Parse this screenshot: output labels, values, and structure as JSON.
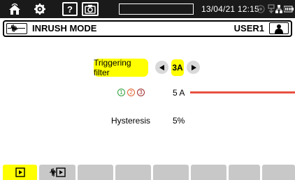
{
  "statusbar": {
    "datetime": "13/04/21 12:15",
    "progress": 0,
    "icons": [
      "home-wifi-icon",
      "settings-icon",
      "help-icon",
      "camera-icon",
      "record-icon",
      "usb-icon",
      "network-icon",
      "battery-icon"
    ]
  },
  "titlebar": {
    "mode_title": "INRUSH MODE",
    "user_label": "USER1",
    "mode_icon": "inrush-waveform-icon",
    "user_icon": "user-icon"
  },
  "settings": {
    "triggering_filter_label": "Triggering filter",
    "triggering_filter_value": "3A",
    "phases": [
      "1",
      "2",
      "3"
    ],
    "phase_colors": [
      "#2e9e3a",
      "#e06030",
      "#a02a2a"
    ],
    "threshold_value": "5 A",
    "threshold_color": "#e85040",
    "hysteresis_label": "Hysteresis",
    "hysteresis_value": "5%"
  },
  "colors": {
    "highlight": "#ffff00",
    "statusbar_bg": "#1a1a1a",
    "tab_inactive": "#c8c8c8"
  },
  "tabs": [
    {
      "icon": "start-icon",
      "active": true
    },
    {
      "icon": "triggered-start-icon",
      "active": false
    },
    {
      "icon": "",
      "active": false
    },
    {
      "icon": "",
      "active": false
    },
    {
      "icon": "",
      "active": false
    },
    {
      "icon": "",
      "active": false
    },
    {
      "icon": "",
      "active": false
    },
    {
      "icon": "",
      "active": false
    }
  ]
}
